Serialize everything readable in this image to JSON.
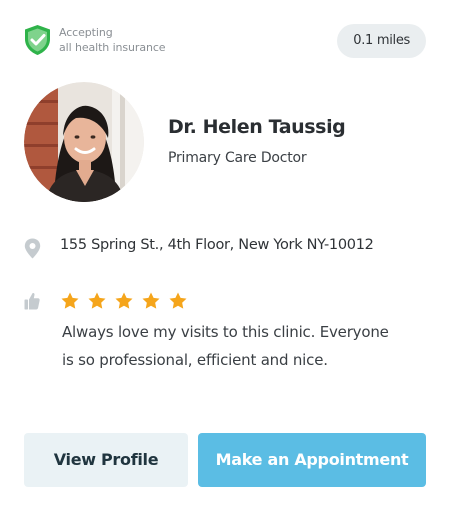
{
  "insurance": {
    "line1": "Accepting",
    "line2": "all health insurance",
    "icon": "shield-check-icon",
    "icon_color": "#2fb34a"
  },
  "distance": "0.1 miles",
  "doctor": {
    "name": "Dr. Helen Taussig",
    "title": "Primary Care Doctor"
  },
  "address": {
    "icon": "location-pin-icon",
    "text": "155 Spring St., 4th Floor, New York NY-10012"
  },
  "review": {
    "icon": "thumbs-up-icon",
    "rating": 5,
    "max_rating": 5,
    "star_color": "#f5a51b",
    "text": "Always love my visits to this clinic. Everyone is so professional, efficient and nice."
  },
  "buttons": {
    "view_profile": "View Profile",
    "make_appointment": "Make an Appointment"
  },
  "colors": {
    "accent": "#5bbde4",
    "secondary_button": "#eaf2f5",
    "pill": "#eaeef0"
  }
}
